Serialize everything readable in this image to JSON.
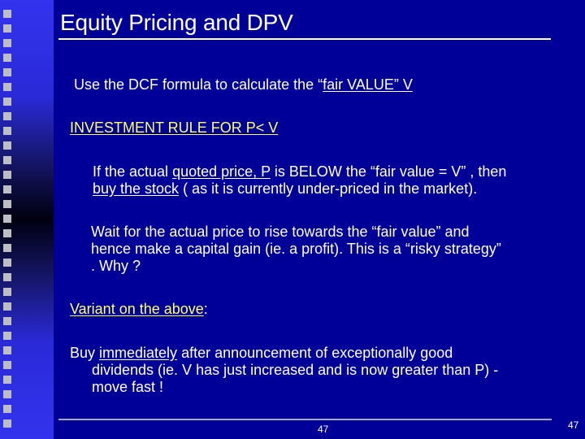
{
  "slide": {
    "title": "Equity Pricing and DPV",
    "line1": {
      "prefix": "Use the DCF formula to calculate the “",
      "underlined": "fair VALUE”  V"
    },
    "rule_heading": "INVESTMENT RULE FOR P< V",
    "p1": {
      "a": "If the actual ",
      "a_u": "quoted price, P",
      "b": " is BELOW the “fair value = V” , then",
      "c_u": "buy the stock",
      "d": " ( as it is currently under-priced in  the market)."
    },
    "p2": {
      "l1": "Wait for the actual price to rise towards the “fair value” and",
      "l2": "hence make a capital gain (ie. a profit).  This is a “risky strategy”",
      "l3": ".  Why ?"
    },
    "variant": {
      "label": "Variant on the above",
      "suffix": ":"
    },
    "p3": {
      "a": "Buy ",
      "a_u": "immediately",
      "b": " after announcement of exceptionally good",
      "l2": "dividends (ie. V has just increased and is now greater than P) -",
      "l3": "move fast !"
    },
    "footer_number": "47",
    "slide_number": "47"
  },
  "colors": {
    "background": "#000099",
    "heading_yellow": "#ffff66",
    "text": "#ffffff",
    "bullet_squares": "#bdbdc6"
  }
}
